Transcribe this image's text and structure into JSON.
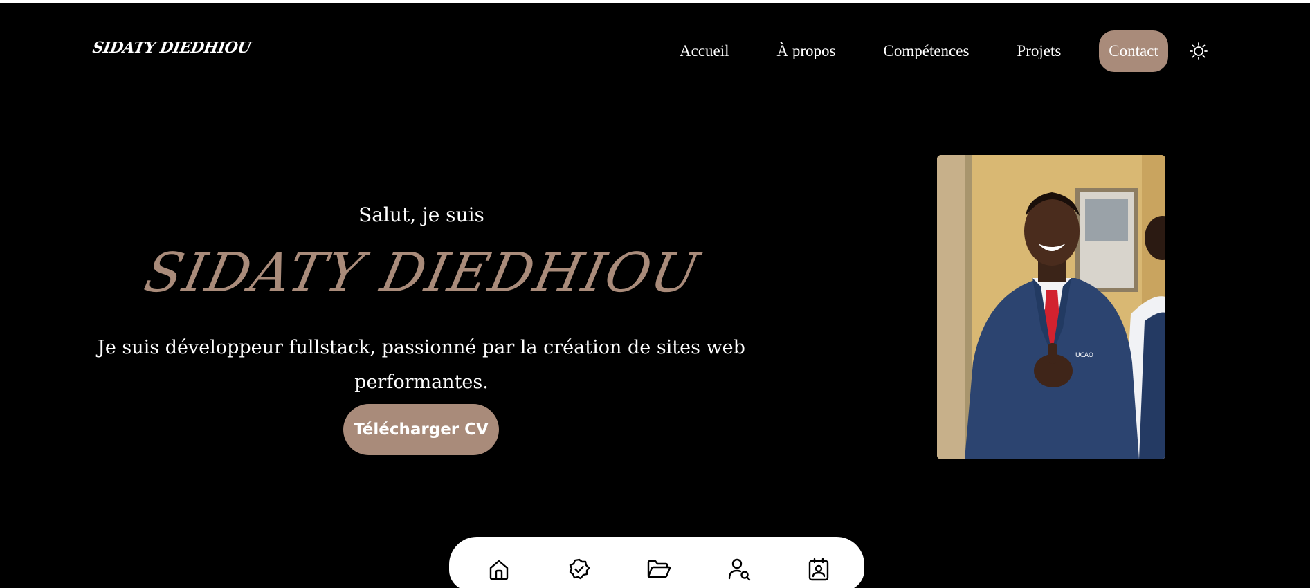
{
  "header": {
    "logo": "SIDATY DIEDHIOU",
    "nav": [
      {
        "label": "Accueil"
      },
      {
        "label": "À propos"
      },
      {
        "label": "Compétences"
      },
      {
        "label": "Projets"
      },
      {
        "label": "Contact",
        "active": true
      }
    ],
    "theme_icon": "sun-icon"
  },
  "hero": {
    "greeting": "Salut, je suis",
    "name": "SIDATY DIEDHIOU",
    "tagline": "Je suis développeur fullstack, passionné par la création de sites web performantes.",
    "cv_button": "Télécharger CV"
  },
  "dock": {
    "icons": [
      "home-icon",
      "verified-badge-icon",
      "folder-open-icon",
      "user-search-icon",
      "contact-card-icon"
    ]
  },
  "colors": {
    "background": "#000000",
    "accent": "#a98b7a",
    "text": "#ffffff",
    "dock": "#ffffff"
  }
}
